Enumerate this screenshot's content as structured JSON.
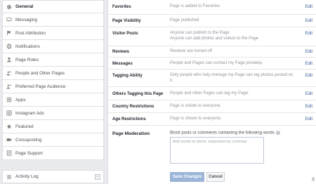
{
  "sidebar": {
    "items": [
      {
        "label": "General",
        "icon": "gear-icon"
      },
      {
        "label": "Messaging",
        "icon": "message-icon"
      },
      {
        "label": "Post Attribution",
        "icon": "flag-icon"
      },
      {
        "label": "Notifications",
        "icon": "globe-icon"
      },
      {
        "label": "Page Roles",
        "icon": "person-icon"
      },
      {
        "label": "People and Other Pages",
        "icon": "people-icon"
      },
      {
        "label": "Preferred Page Audience",
        "icon": "people-icon"
      },
      {
        "label": "Apps",
        "icon": "apps-icon"
      },
      {
        "label": "Instagram Ads",
        "icon": "camera-icon"
      },
      {
        "label": "Featured",
        "icon": "star-icon"
      },
      {
        "label": "Crossposting",
        "icon": "video-icon"
      },
      {
        "label": "Page Support",
        "icon": "document-icon"
      }
    ],
    "activity_log": {
      "label": "Activity Log",
      "icon": "list-icon",
      "arrow": "+"
    }
  },
  "settings": {
    "edit_label": "Edit",
    "rows": [
      {
        "label": "Favorites",
        "value": "Page is added to Favorites"
      },
      {
        "label": "Page Visibility",
        "value": "Page published"
      },
      {
        "label": "Visitor Posts",
        "value": "Anyone can publish to the Page",
        "value2": "Anyone can add photos and videos to the Page"
      },
      {
        "label": "Reviews",
        "value": "Reviews are turned off"
      },
      {
        "label": "Messages",
        "value": "People and Pages can contact my Page privately."
      },
      {
        "label": "Tagging Ability",
        "value": "Only people who help manage my Page can tag photos posted on",
        "value2": "it."
      },
      {
        "label": "Others Tagging this Page",
        "value": "People and other Pages can tag my Page."
      },
      {
        "label": "Country Restrictions",
        "value": "Page is visible to everyone."
      },
      {
        "label": "Age Restrictions",
        "value": "Page is shown to everyone."
      }
    ]
  },
  "moderation": {
    "label": "Page Moderation",
    "description": "Block posts or comments containing the following words",
    "help": "?",
    "placeholder": "Add words to block, separated by commas",
    "save_label": "Save Changes",
    "cancel_label": "Cancel"
  },
  "colors": {
    "link": "#365899",
    "save_button": "#9cb4d8"
  }
}
